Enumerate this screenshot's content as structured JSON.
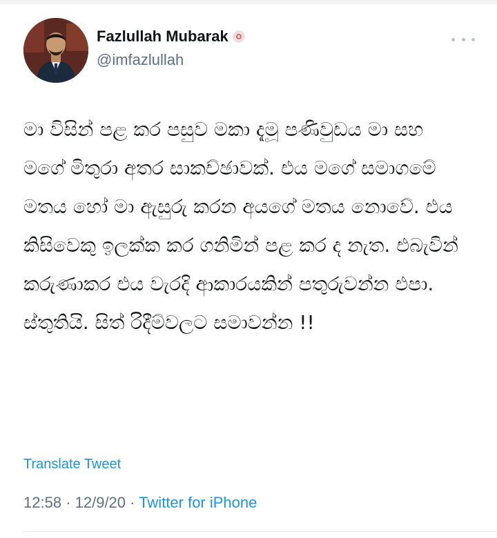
{
  "author": {
    "display_name": "Fazlullah Mubarak",
    "handle": "@imfazlullah",
    "avatar_icon": "profile-photo",
    "badge_icon": "verified-badge-icon"
  },
  "menu": {
    "more_icon": "more-options-icon"
  },
  "tweet": {
    "text": "මා විසින් පළ කර පසුව මකා දැමූ පණිවුඩය මා සහ මගේ මිතුරා අතර සාකච්ඡාවක්. එය මගේ සමාගමේ මතය හෝ මා ඇසුරු කරන අයගේ මතය නොවේ. එය කිසිවෙකු ඉලක්ක කර ගනිමින් පළ කර ද නැත. එබැවින් කරුණාකර එය වැරදි ආකාරයකින් පතුරුවන්න එපා. ස්තුතියි. සිත් රිදීම්වලට සමාවන්න !!",
    "translate_label": "Translate Tweet",
    "time": "12:58",
    "separator_1": " · ",
    "date": "12/9/20",
    "separator_2": " · ",
    "source": "Twitter for iPhone"
  },
  "colors": {
    "link": "#1b95e0",
    "secondary_text": "#5b7083",
    "primary_text": "#0f1419"
  }
}
